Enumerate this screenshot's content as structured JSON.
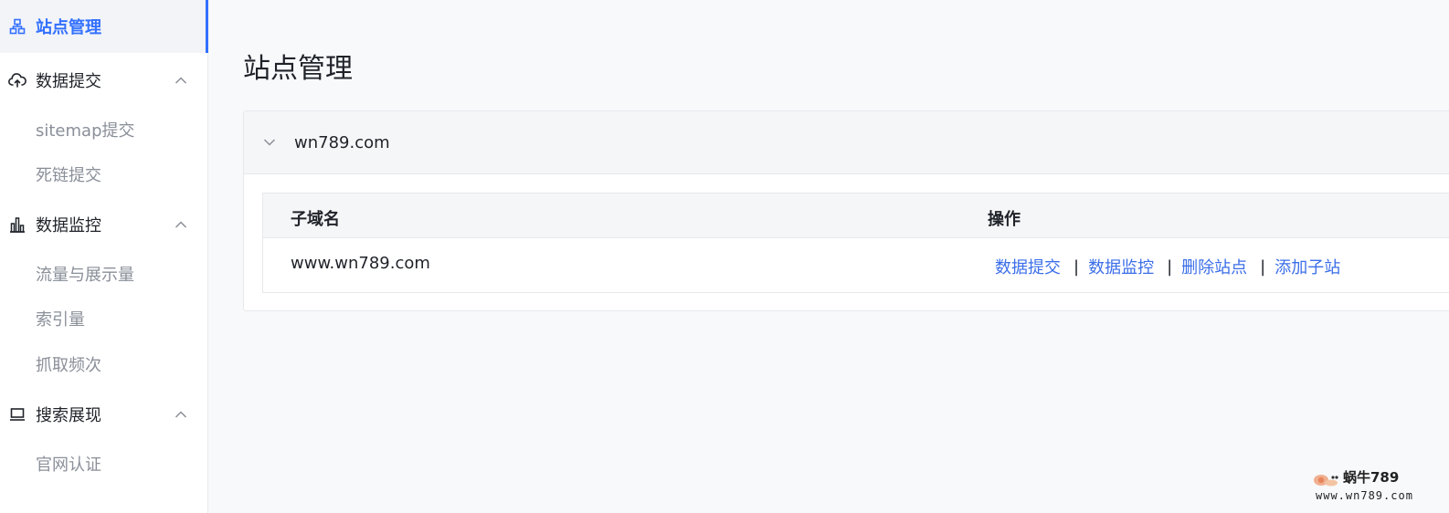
{
  "sidebar": {
    "active_item": {
      "label": "站点管理",
      "icon": "sitemap-icon"
    },
    "groups": [
      {
        "label": "数据提交",
        "icon": "cloud-upload-icon",
        "expanded": true,
        "items": [
          {
            "label": "sitemap提交"
          },
          {
            "label": "死链提交"
          }
        ]
      },
      {
        "label": "数据监控",
        "icon": "bar-chart-icon",
        "expanded": true,
        "items": [
          {
            "label": "流量与展示量"
          },
          {
            "label": "索引量"
          },
          {
            "label": "抓取频次"
          }
        ]
      },
      {
        "label": "搜索展现",
        "icon": "monitor-icon",
        "expanded": true,
        "items": [
          {
            "label": "官网认证"
          }
        ]
      }
    ],
    "accent_color": "#3370ff"
  },
  "main": {
    "title": "站点管理",
    "site_card": {
      "domain": "wn789.com",
      "table": {
        "columns": [
          "子域名",
          "操作"
        ],
        "rows": [
          {
            "subdomain": "www.wn789.com",
            "actions": [
              "数据提交",
              "数据监控",
              "删除站点",
              "添加子站"
            ]
          }
        ]
      }
    },
    "link_color": "#3b6ee8"
  },
  "watermark": {
    "line1": "蜗牛789",
    "line2": "www.wn789.com"
  }
}
